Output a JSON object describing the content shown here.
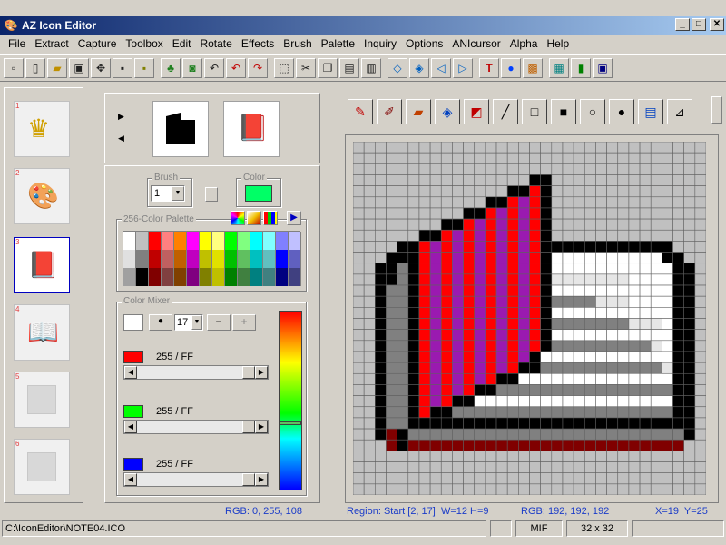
{
  "window": {
    "title": "AZ Icon Editor",
    "app_icon": "palette-icon",
    "minimize": "_",
    "maximize": "□",
    "close": "✕"
  },
  "menu": [
    "File",
    "Extract",
    "Capture",
    "Toolbox",
    "Edit",
    "Rotate",
    "Effects",
    "Brush",
    "Palette",
    "Inquiry",
    "Options",
    "ANIcursor",
    "Alpha",
    "Help"
  ],
  "toolbar_icons": [
    "new-icon",
    "new-page-icon",
    "open-folder-icon",
    "capture-icon",
    "extract-icon",
    "save-icon",
    "save-all-icon",
    "tree-icon",
    "camera-icon",
    "undo-all-icon",
    "undo-icon",
    "redo-icon",
    "select-icon",
    "cut-icon",
    "copy-icon",
    "paste-icon",
    "paste-special-icon",
    "flip-horizontal-icon",
    "flip-vertical-icon",
    "rotate-left-icon",
    "rotate-right-icon",
    "text-icon",
    "sphere-icon",
    "bitmap-icon",
    "resource-icon",
    "film-icon",
    "preview-icon"
  ],
  "icon_slots": [
    {
      "num": "1",
      "icon": "crown-icon"
    },
    {
      "num": "2",
      "icon": "paint-palette-icon"
    },
    {
      "num": "3",
      "icon": "red-book-icon"
    },
    {
      "num": "4",
      "icon": "open-book-icon"
    },
    {
      "num": "5",
      "icon": "empty-slot-icon"
    },
    {
      "num": "6",
      "icon": "empty-slot-icon"
    }
  ],
  "brush": {
    "label": "Brush",
    "value": "1"
  },
  "color_group_label": "Color",
  "current_color": "#00ff66",
  "palette": {
    "label": "256-Color Palette",
    "colors": [
      [
        "#ffffff",
        "#c0c0c0",
        "#ff0000",
        "#ff8080",
        "#ff8000",
        "#ff00ff",
        "#ffff00",
        "#ffff80",
        "#00ff00",
        "#80ff80",
        "#00ffff",
        "#80ffff",
        "#8080ff",
        "#c0c0ff"
      ],
      [
        "#e0e0e0",
        "#808080",
        "#c00000",
        "#c06060",
        "#c06000",
        "#c000c0",
        "#c0c000",
        "#e0e000",
        "#00c000",
        "#60c060",
        "#00c0c0",
        "#60c0c0",
        "#0000ff",
        "#6060c0"
      ],
      [
        "#a0a0a0",
        "#000000",
        "#800000",
        "#804040",
        "#804000",
        "#800080",
        "#808000",
        "#c0c000",
        "#008000",
        "#408040",
        "#008080",
        "#408080",
        "#000080",
        "#404080"
      ]
    ]
  },
  "mixer": {
    "label": "Color Mixer",
    "size_value": "17",
    "minus": "−",
    "plus": "+",
    "channels": [
      {
        "color": "#ff0000",
        "value_text": "255 / FF",
        "fraction": 1.0
      },
      {
        "color": "#00ff00",
        "value_text": "255 / FF",
        "fraction": 1.0
      },
      {
        "color": "#0000ff",
        "value_text": "255 / FF",
        "fraction": 1.0
      }
    ]
  },
  "draw_tools": [
    "pencil-icon",
    "eraser-icon",
    "brush-icon",
    "fill-icon",
    "color-replace-icon",
    "line-icon",
    "rectangle-icon",
    "filled-rectangle-icon",
    "ellipse-icon",
    "filled-ellipse-icon",
    "stamp-icon",
    "eyedropper-icon"
  ],
  "status": {
    "rgb_left": "RGB: 0, 255, 108",
    "region": "Region: Start [2, 17]  W=12 H=9",
    "rgb_right": "RGB: 192, 192, 192",
    "coords": "X=19  Y=25"
  },
  "statusbar": {
    "path": "C:\\IconEditor\\NOTE04.ICO",
    "format": "MIF",
    "size": "32 x 32"
  },
  "icon_pixels": {
    "palette_map": {
      "g": "#c0c0c0",
      "k": "#000000",
      "r": "#ff0000",
      "p": "#9a1ab0",
      "w": "#ffffff",
      "m": "#808080",
      "d": "#800000",
      "l": "#e6e6e6"
    },
    "rows": [
      "gggggggggggggggggggggggggggggggg",
      "gggggggggggggggggggggggggggggggg",
      "gggggggggggggggggggggggggggggggg",
      "ggggggggggggggggkkgggggggggggggg",
      "ggggggggggggggkkrkgggggggggggggg",
      "ggggggggggggkkrprkgggggggggggggg",
      "ggggggggggkkrprprkgggggggggggggg",
      "ggggggggkkrprprprkgggggggggggggg",
      "ggggggkkrprprprprkgggggggggggggg",
      "ggggkkrprprprprprkkkkkkkkkkkkggg",
      "gggkkkrprprprprprkwwwwwwwwwwkkgg",
      "ggkkmkrprprprprprkwwwwwwwwwwwkkg",
      "ggkkmkrprprprprprklllllllwwwwkkg",
      "ggkmmkrprprprprprkwwwwwwwwwwwkkg",
      "ggkmmkrprprprprprkmmmmlllwwwwkkg",
      "ggkmmkrprprprprprkwwwwwwwwwwwkkg",
      "ggkmmkrprprprprprkmmmmmmmlllwkkg",
      "ggkmmkrprprprprprkwwwwwwwwwwwkkg",
      "ggkmmkrprprprprprkmmmmmmmmmlwkkg",
      "ggkmmkrprprprprpkwwwwwwwwwwwwkkg",
      "ggkmmkrprprprprkkmmmmmmmmmmmlkkg",
      "ggkmmkrprprprkkwwwwwwwwwwwwwwkkg",
      "ggkmmkrprprkkmmmmmmmmmmmmmmmmkkg",
      "ggkmmkrprkkwwwwwwwwwwwwwwwwwwkkg",
      "ggkmmkrkkmmmmmmmmmmmmmmmmmmmmkkg",
      "ggkmmkkkkkkkkkkkkkkkkkkkkkkkkkkg",
      "ggkdkmmmmmmmmmmmmmmmmmmmmmmmmmkg",
      "gggdkdddddddddddddddddddddddddgg",
      "gggggggggggggggggggggggggggggggg",
      "gggggggggggggggggggggggggggggggg",
      "gggggggggggggggggggggggggggggggg",
      "gggggggggggggggggggggggggggggggg"
    ]
  }
}
